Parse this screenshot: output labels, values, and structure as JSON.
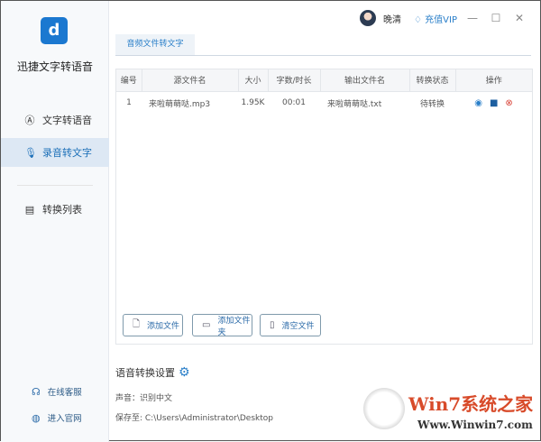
{
  "app": {
    "name": "迅捷文字转语音",
    "logo_glyph": "d"
  },
  "sidebar": {
    "items": [
      {
        "label": "文字转语音",
        "icon": "text-a-icon"
      },
      {
        "label": "录音转文字",
        "icon": "microphone-icon",
        "active": true
      },
      {
        "label": "转换列表",
        "icon": "list-doc-icon"
      }
    ],
    "footer": [
      {
        "label": "在线客服",
        "icon": "headset-icon"
      },
      {
        "label": "进入官网",
        "icon": "globe-icon"
      }
    ]
  },
  "topbar": {
    "user": "晚清",
    "vip": "充值VIP"
  },
  "tab": "音频文件转文字",
  "table": {
    "headers": [
      "编号",
      "源文件名",
      "大小",
      "字数/时长",
      "输出文件名",
      "转换状态",
      "操作"
    ],
    "rows": [
      {
        "no": "1",
        "src": "来啦萌萌哒.mp3",
        "size": "1.95K",
        "duration": "00:01",
        "out": "来啦萌萌哒.txt",
        "status": "待转换"
      }
    ]
  },
  "buttons": {
    "add_file": "添加文件",
    "add_folder": "添加文件夹",
    "clear": "清空文件"
  },
  "settings": {
    "title": "语音转换设置",
    "voice": "声音：识别中文",
    "save_to": "保存至: C:\\Users\\Administrator\\Desktop"
  },
  "watermark": {
    "title": "Win7系统之家",
    "url": "Www.Winwin7.com"
  },
  "colors": {
    "accent": "#2a7fc9",
    "active_bg": "#dde8f4",
    "delete": "#d9453a"
  }
}
